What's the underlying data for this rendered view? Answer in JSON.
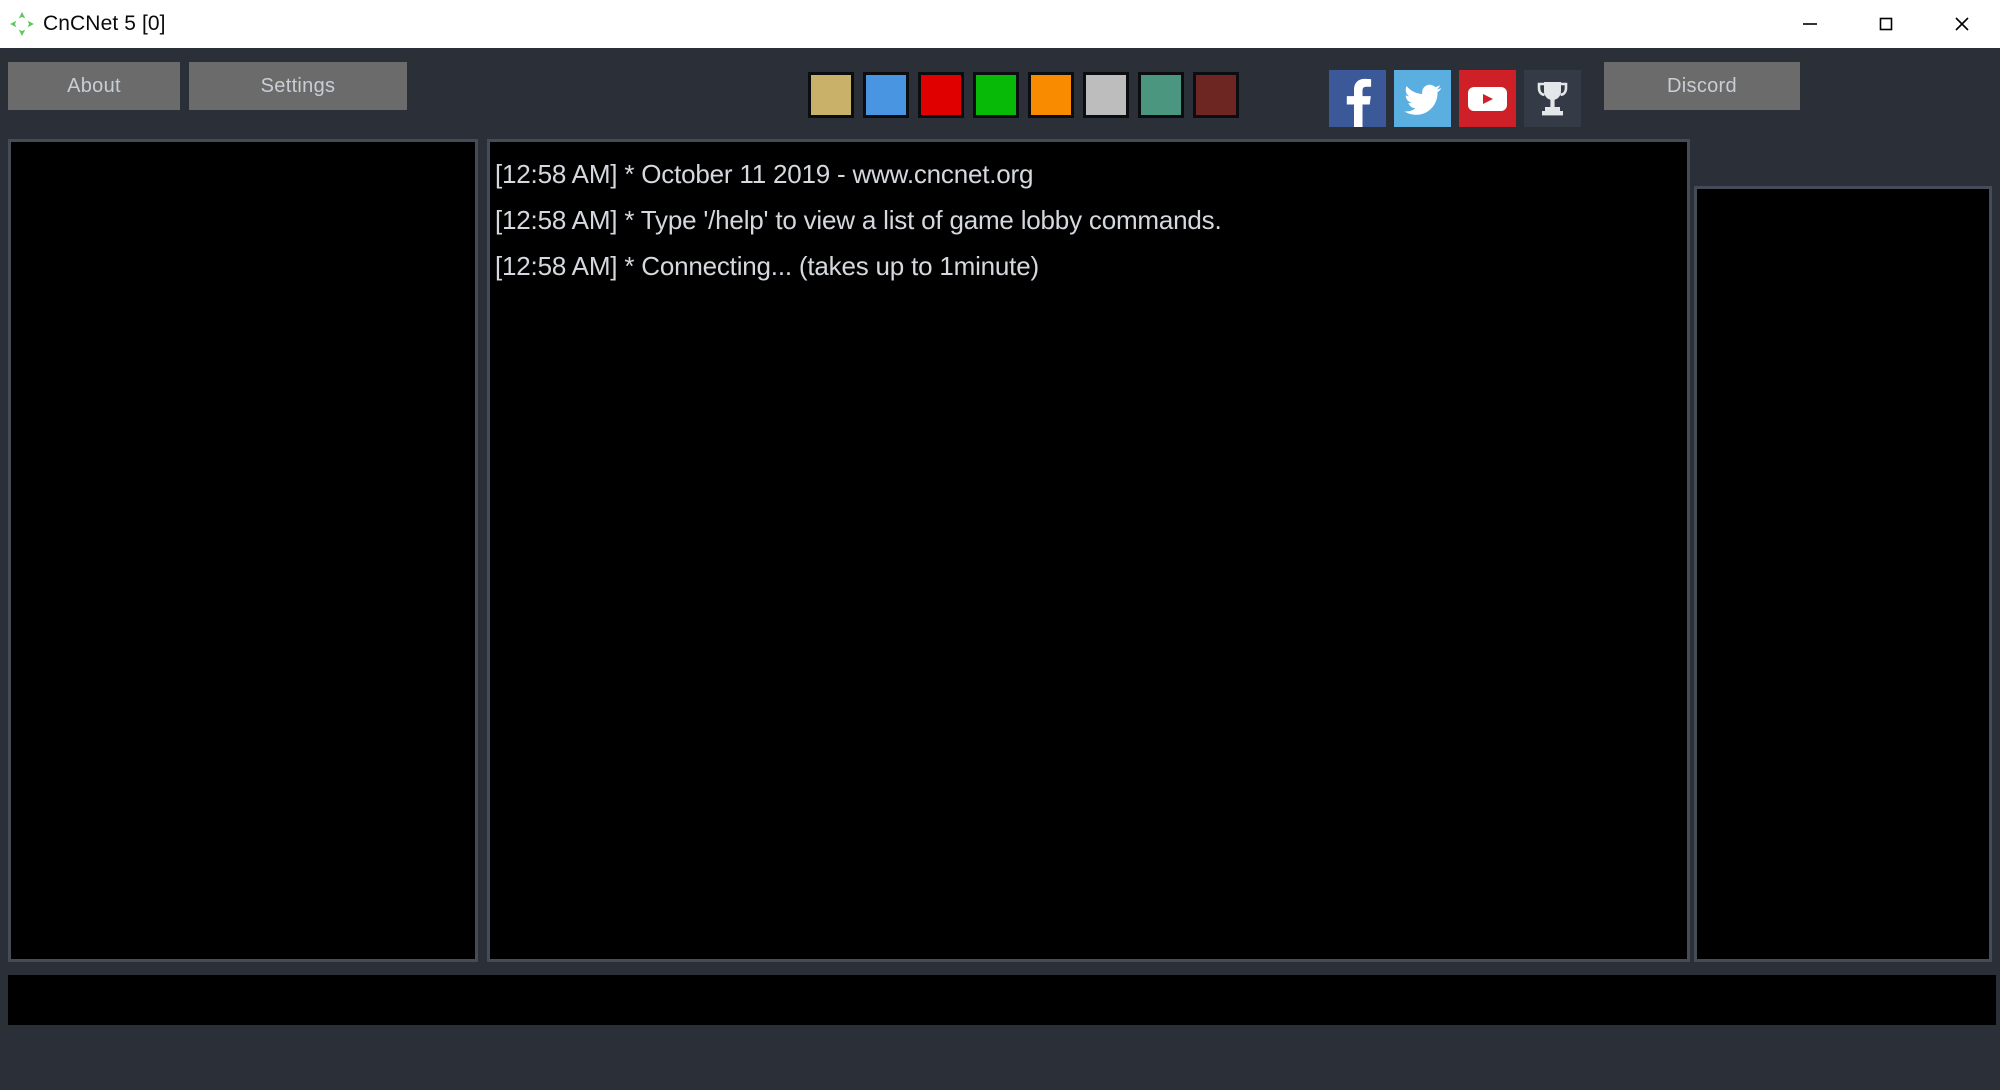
{
  "window": {
    "title": "CnCNet 5 [0]",
    "logo_icon": "cncnet-logo-icon",
    "controls": [
      {
        "name": "minimize-button",
        "icon": "minimize-icon"
      },
      {
        "name": "maximize-button",
        "icon": "maximize-icon"
      },
      {
        "name": "close-button",
        "icon": "close-icon"
      }
    ]
  },
  "toolbar": {
    "about_label": "About",
    "settings_label": "Settings",
    "discord_label": "Discord",
    "button_bg": "#6b6b6b",
    "button_text_color": "#c9cdd4",
    "color_swatches": [
      {
        "name": "color-swatch-gold",
        "hex": "#c9b16a"
      },
      {
        "name": "color-swatch-blue",
        "hex": "#4a95e2"
      },
      {
        "name": "color-swatch-red",
        "hex": "#e00000"
      },
      {
        "name": "color-swatch-green",
        "hex": "#07ba07"
      },
      {
        "name": "color-swatch-orange",
        "hex": "#f98b00"
      },
      {
        "name": "color-swatch-lightgray",
        "hex": "#bdbdbd"
      },
      {
        "name": "color-swatch-teal",
        "hex": "#4a967f"
      },
      {
        "name": "color-swatch-maroon",
        "hex": "#6d2622"
      }
    ],
    "socials": [
      {
        "name": "facebook-button",
        "icon": "facebook-icon",
        "hex": "#3b5998"
      },
      {
        "name": "twitter-button",
        "icon": "twitter-icon",
        "hex": "#5aaee0"
      },
      {
        "name": "youtube-button",
        "icon": "youtube-icon",
        "hex": "#cf2028"
      },
      {
        "name": "ladder-button",
        "icon": "trophy-icon",
        "hex": "#343a46"
      }
    ]
  },
  "chat": {
    "lines": [
      "[12:58 AM] * October 11 2019 - www.cncnet.org",
      "[12:58 AM] * Type '/help' to view a list of game lobby commands.",
      "[12:58 AM] * Connecting... (takes up to 1minute)"
    ],
    "text_color": "#d5d9de",
    "background": "#000000",
    "input_value": "",
    "input_placeholder": ""
  },
  "players_panel": {
    "items": [],
    "background": "#000000"
  },
  "side_panel": {
    "background": "#000000",
    "items": [],
    "icons": [
      {
        "name": "sort-rose-icon",
        "label": "rose-and-paper-icon"
      },
      {
        "name": "soviet-flag-icon",
        "label": "soviet-flag-icon"
      },
      {
        "name": "eye-icon",
        "label": "eye-icon"
      },
      {
        "name": "eagle-coin-icon",
        "label": "eagle-medallion-icon"
      },
      {
        "name": "chat-bubble-icon",
        "label": "speech-bubble-icon"
      },
      {
        "name": "heart-icon",
        "label": "heart-icon"
      }
    ]
  },
  "theme": {
    "app_background": "#2b3038",
    "titlebar_background": "#ffffff",
    "panel_border": "#454b57",
    "panel_background": "#000000"
  }
}
